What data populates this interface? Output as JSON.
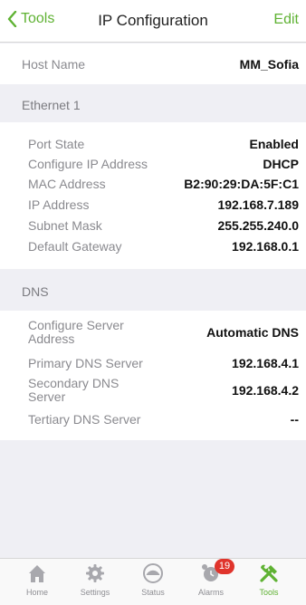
{
  "navbar": {
    "back_label": "Tools",
    "title": "IP Configuration",
    "edit_label": "Edit"
  },
  "host": {
    "label": "Host Name",
    "value": "MM_Sofia"
  },
  "ethernet": {
    "header": "Ethernet 1",
    "rows": [
      {
        "label": "Port State",
        "value": "Enabled"
      },
      {
        "label": "Configure IP Address",
        "value": "DHCP"
      },
      {
        "label": "MAC Address",
        "value": "B2:90:29:DA:5F:C1"
      },
      {
        "label": "IP Address",
        "value": "192.168.7.189"
      },
      {
        "label": "Subnet Mask",
        "value": "255.255.240.0"
      },
      {
        "label": "Default Gateway",
        "value": "192.168.0.1"
      }
    ]
  },
  "dns": {
    "header": "DNS",
    "rows": [
      {
        "label_line1": "Configure Server",
        "label_line2": "Address",
        "value": "Automatic DNS"
      },
      {
        "label": "Primary DNS Server",
        "value": "192.168.4.1"
      },
      {
        "label_line1": "Secondary DNS",
        "label_line2": "Server",
        "value": "192.168.4.2"
      },
      {
        "label": "Tertiary DNS Server",
        "value": "--"
      }
    ]
  },
  "tabbar": {
    "tabs": [
      {
        "label": "Home",
        "icon": "home-icon"
      },
      {
        "label": "Settings",
        "icon": "gear-icon"
      },
      {
        "label": "Status",
        "icon": "gauge-icon"
      },
      {
        "label": "Alarms",
        "icon": "alarm-clock-icon",
        "badge": "19"
      },
      {
        "label": "Tools",
        "icon": "tools-icon",
        "active": true
      }
    ]
  },
  "colors": {
    "accent": "#5fb233",
    "badge": "#e0342c",
    "background": "#efeff4"
  }
}
